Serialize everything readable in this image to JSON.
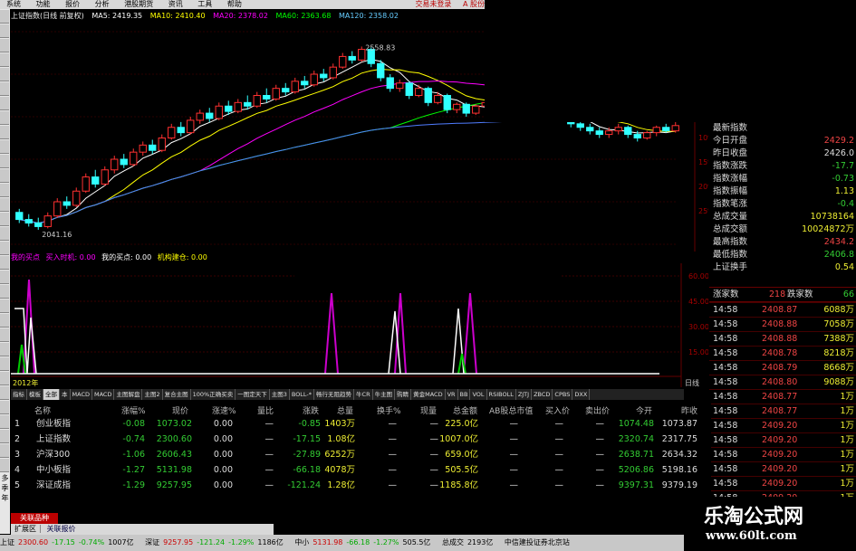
{
  "menu": {
    "items": [
      "系统",
      "功能",
      "报价",
      "分析",
      "港股期货",
      "资讯",
      "工具",
      "帮助"
    ],
    "right_text": "交易未登录",
    "right_text2": "A 股份"
  },
  "left_toolbar": {
    "labels": [
      "多",
      "季",
      "年"
    ]
  },
  "chart_header": {
    "title": "上证指数(日线 前复权)",
    "ma5": "MA5: 2419.35",
    "ma10": "MA10: 2410.40",
    "ma20": "MA20: 2378.02",
    "ma60": "MA60: 2363.68",
    "ma120": "MA120: 2358.02",
    "high_label": "2558.83",
    "low_label": "2041.16"
  },
  "ma_colors": {
    "ma5": "#ffffff",
    "ma10": "#ffff00",
    "ma20": "#ff00ff",
    "ma60": "#00ff00",
    "ma120": "#4f7cff"
  },
  "indicator_header": {
    "line1": "我的买点",
    "buy": "买入时机: 0.00",
    "mybuy": "我的买点: 0.00",
    "inst": "机构建仓: 0.00"
  },
  "axis": {
    "pct_ticks": [
      "10%",
      "15%",
      "20%",
      "25%"
    ],
    "ind_ticks": [
      "60.00",
      "45.00",
      "30.00",
      "15.00"
    ],
    "year_label": "2012年",
    "period_label": "日线"
  },
  "info_panel": {
    "rows": [
      {
        "k": "最新指数",
        "v": ""
      },
      {
        "k": "今日开盘",
        "v": "2429.2"
      },
      {
        "k": "昨日收盘",
        "v": "2426.0"
      },
      {
        "k": "指数涨跌",
        "v": "-17.7"
      },
      {
        "k": "指数涨幅",
        "v": "-0.73"
      },
      {
        "k": "指数振幅",
        "v": "1.13"
      },
      {
        "k": "指数笔涨",
        "v": "-0.4"
      },
      {
        "k": "总成交量",
        "v": "10738164"
      },
      {
        "k": "总成交额",
        "v": "10024872万"
      },
      {
        "k": "最高指数",
        "v": "2434.2"
      },
      {
        "k": "最低指数",
        "v": "2406.8"
      },
      {
        "k": "上证换手",
        "v": "0.54"
      }
    ],
    "up_label": "涨家数",
    "up_count": "218",
    "down_label": "跌家数",
    "down_count": "66"
  },
  "ticks": [
    {
      "t": "14:58",
      "p": "2408.87",
      "vol": "6088万"
    },
    {
      "t": "14:58",
      "p": "2408.88",
      "vol": "7058万"
    },
    {
      "t": "14:58",
      "p": "2408.88",
      "vol": "7388万"
    },
    {
      "t": "14:58",
      "p": "2408.78",
      "vol": "8218万"
    },
    {
      "t": "14:58",
      "p": "2408.79",
      "vol": "8668万"
    },
    {
      "t": "14:58",
      "p": "2408.80",
      "vol": "9088万"
    },
    {
      "t": "14:58",
      "p": "2408.77",
      "vol": "1万"
    },
    {
      "t": "14:58",
      "p": "2408.77",
      "vol": "1万"
    },
    {
      "t": "14:58",
      "p": "2409.20",
      "vol": "1万"
    },
    {
      "t": "14:58",
      "p": "2409.20",
      "vol": "1万"
    },
    {
      "t": "14:58",
      "p": "2409.20",
      "vol": "1万"
    },
    {
      "t": "14:58",
      "p": "2409.20",
      "vol": "1万"
    },
    {
      "t": "14:58",
      "p": "2409.20",
      "vol": "1万"
    },
    {
      "t": "14:58",
      "p": "2409.20",
      "vol": "1万"
    },
    {
      "t": "14:58",
      "p": "2409.20",
      "vol": "1万"
    },
    {
      "t": "14:58",
      "p": "2409.20",
      "vol": "1万"
    }
  ],
  "toolbar": {
    "items": [
      "指标",
      "模板",
      "全部",
      "本",
      "MACD",
      "MACD",
      "主图解盘",
      "主图2",
      "复合主图",
      "100%正确买卖",
      "一图定天下",
      "主图3",
      "BOLL-*",
      "畅行无阻趋势",
      "牛CR",
      "牛主图",
      "购睛",
      "黄金MACD",
      "VR",
      "BB",
      "VOL",
      "RSIBOLL",
      "ZJTJ",
      "ZBCD",
      "CPBS",
      "DXX"
    ]
  },
  "table": {
    "headers": [
      "名称",
      "涨幅%",
      "现价",
      "涨速%",
      "量比",
      "涨跌",
      "总量",
      "换手%",
      "现量",
      "总金额",
      "AB股总市值",
      "买入价",
      "卖出价",
      "今开",
      "昨收"
    ],
    "rows": [
      {
        "no": "1",
        "name": "创业板指",
        "chg": "-0.08",
        "price": "1073.02",
        "spd": "0.00",
        "ratio": "—",
        "diff": "-0.85",
        "vol": "1403万",
        "turn": "—",
        "cur": "—",
        "amt": "225.0亿",
        "mcap": "—",
        "bid": "—",
        "ask": "—",
        "open": "1074.48",
        "prev": "1073.87"
      },
      {
        "no": "2",
        "name": "上证指数",
        "chg": "-0.74",
        "price": "2300.60",
        "spd": "0.00",
        "ratio": "—",
        "diff": "-17.15",
        "vol": "1.08亿",
        "turn": "—",
        "cur": "—",
        "amt": "1007.0亿",
        "mcap": "—",
        "bid": "—",
        "ask": "—",
        "open": "2320.74",
        "prev": "2317.75"
      },
      {
        "no": "3",
        "name": "沪深300",
        "chg": "-1.06",
        "price": "2606.43",
        "spd": "0.00",
        "ratio": "—",
        "diff": "-27.89",
        "vol": "6252万",
        "turn": "—",
        "cur": "—",
        "amt": "659.0亿",
        "mcap": "—",
        "bid": "—",
        "ask": "—",
        "open": "2638.71",
        "prev": "2634.32"
      },
      {
        "no": "4",
        "name": "中小板指",
        "chg": "-1.27",
        "price": "5131.98",
        "spd": "0.00",
        "ratio": "—",
        "diff": "-66.18",
        "vol": "4078万",
        "turn": "—",
        "cur": "—",
        "amt": "505.5亿",
        "mcap": "—",
        "bid": "—",
        "ask": "—",
        "open": "5206.86",
        "prev": "5198.16"
      },
      {
        "no": "5",
        "name": "深证成指",
        "chg": "-1.29",
        "price": "9257.95",
        "spd": "0.00",
        "ratio": "—",
        "diff": "-121.24",
        "vol": "1.28亿",
        "turn": "—",
        "cur": "—",
        "amt": "1185.8亿",
        "mcap": "—",
        "bid": "—",
        "ask": "—",
        "open": "9397.31",
        "prev": "9379.19"
      }
    ]
  },
  "tabs": {
    "related": "关联品种",
    "expand": "扩展区",
    "ref": "关联报价"
  },
  "bottombar": {
    "sh": "上证",
    "sh_val": "2300.60",
    "sh_chg": "-17.15",
    "sh_pct": "-0.74%",
    "sh_amt": "1007亿",
    "sz": "深证",
    "sz_val": "9257.95",
    "sz_chg": "-121.24",
    "sz_pct": "-1.29%",
    "sz_amt": "1186亿",
    "zx": "中小",
    "zx_val": "5131.98",
    "zx_chg": "-66.18",
    "zx_pct": "-1.27%",
    "zx_amt": "505.5亿",
    "total_label": "总成交",
    "total": "2193亿",
    "broker": "中信建投证券北京站"
  },
  "watermark": {
    "line1": "乐淘公式网",
    "line2": "www.60lt.com"
  },
  "chart_data": {
    "type": "candlestick",
    "candles": [
      [
        2090,
        2070,
        2100,
        2060
      ],
      [
        2070,
        2060,
        2085,
        2050
      ],
      [
        2060,
        2050,
        2075,
        2041
      ],
      [
        2050,
        2080,
        2090,
        2045
      ],
      [
        2080,
        2120,
        2130,
        2075
      ],
      [
        2120,
        2110,
        2135,
        2100
      ],
      [
        2110,
        2150,
        2160,
        2105
      ],
      [
        2150,
        2190,
        2200,
        2145
      ],
      [
        2190,
        2170,
        2210,
        2160
      ],
      [
        2170,
        2210,
        2220,
        2165
      ],
      [
        2210,
        2240,
        2250,
        2200
      ],
      [
        2240,
        2225,
        2255,
        2215
      ],
      [
        2225,
        2260,
        2270,
        2220
      ],
      [
        2260,
        2280,
        2290,
        2250
      ],
      [
        2280,
        2265,
        2295,
        2255
      ],
      [
        2265,
        2300,
        2310,
        2260
      ],
      [
        2300,
        2330,
        2340,
        2295
      ],
      [
        2330,
        2315,
        2345,
        2305
      ],
      [
        2315,
        2350,
        2360,
        2310
      ],
      [
        2350,
        2370,
        2380,
        2340
      ],
      [
        2370,
        2355,
        2385,
        2345
      ],
      [
        2355,
        2390,
        2400,
        2350
      ],
      [
        2390,
        2375,
        2405,
        2365
      ],
      [
        2375,
        2400,
        2410,
        2370
      ],
      [
        2400,
        2390,
        2420,
        2380
      ],
      [
        2390,
        2420,
        2430,
        2385
      ],
      [
        2420,
        2410,
        2440,
        2400
      ],
      [
        2410,
        2440,
        2450,
        2405
      ],
      [
        2440,
        2430,
        2455,
        2420
      ],
      [
        2430,
        2460,
        2470,
        2425
      ],
      [
        2460,
        2450,
        2475,
        2440
      ],
      [
        2450,
        2480,
        2490,
        2445
      ],
      [
        2480,
        2470,
        2495,
        2460
      ],
      [
        2470,
        2500,
        2510,
        2465
      ],
      [
        2500,
        2530,
        2540,
        2495
      ],
      [
        2530,
        2520,
        2545,
        2510
      ],
      [
        2520,
        2550,
        2558,
        2515
      ],
      [
        2550,
        2510,
        2555,
        2500
      ],
      [
        2510,
        2470,
        2520,
        2460
      ],
      [
        2470,
        2440,
        2480,
        2430
      ],
      [
        2440,
        2455,
        2465,
        2430
      ],
      [
        2455,
        2420,
        2460,
        2410
      ],
      [
        2420,
        2440,
        2450,
        2415
      ],
      [
        2440,
        2400,
        2445,
        2390
      ],
      [
        2400,
        2420,
        2430,
        2395
      ],
      [
        2420,
        2380,
        2425,
        2370
      ],
      [
        2380,
        2395,
        2400,
        2370
      ],
      [
        2395,
        2370,
        2400,
        2360
      ],
      [
        2370,
        2390,
        2395,
        2365
      ],
      [
        2390,
        2400,
        2410,
        2380
      ],
      [
        2400,
        2385,
        2410,
        2375
      ],
      [
        2385,
        2410,
        2420,
        2380
      ],
      [
        2410,
        2395,
        2425,
        2385
      ],
      [
        2395,
        2380,
        2400,
        2370
      ],
      [
        2380,
        2365,
        2390,
        2355
      ],
      [
        2365,
        2400,
        2405,
        2360
      ],
      [
        2400,
        2380,
        2410,
        2370
      ],
      [
        2380,
        2360,
        2385,
        2350
      ],
      [
        2360,
        2340,
        2370,
        2330
      ],
      [
        2340,
        2330,
        2350,
        2320
      ],
      [
        2330,
        2320,
        2340,
        2310
      ],
      [
        2320,
        2310,
        2330,
        2300
      ],
      [
        2310,
        2320,
        2330,
        2300
      ],
      [
        2320,
        2330,
        2340,
        2310
      ],
      [
        2330,
        2310,
        2335,
        2300
      ],
      [
        2310,
        2300,
        2320,
        2290
      ],
      [
        2300,
        2315,
        2320,
        2295
      ],
      [
        2315,
        2330,
        2335,
        2305
      ],
      [
        2330,
        2320,
        2340,
        2315
      ],
      [
        2320,
        2335,
        2345,
        2315
      ]
    ],
    "ylim": [
      2000,
      2600
    ],
    "high": "2558.83",
    "low": "2041.16"
  }
}
